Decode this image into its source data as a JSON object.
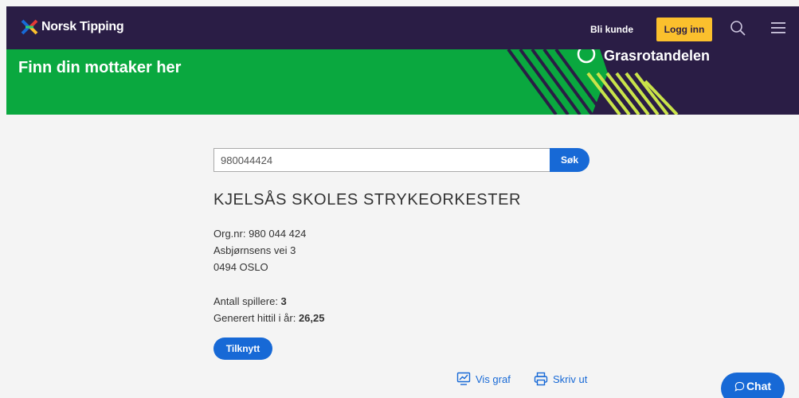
{
  "header": {
    "brand": "Norsk Tipping",
    "bli_kunde": "Bli kunde",
    "logg_inn": "Logg inn",
    "icons": [
      "norsk-tipping-logo-icon",
      "search-icon",
      "menu-icon"
    ]
  },
  "hero": {
    "title": "Finn din mottaker her",
    "badge": "Grasrotandelen"
  },
  "search": {
    "value": "980044424",
    "button": "Søk"
  },
  "org": {
    "name": "KJELSÅS SKOLES STRYKEORKESTER",
    "orgnr": "Org.nr: 980 044 424",
    "address1": "Asbjørnsens vei 3",
    "address2": "0494 OSLO",
    "players_label": "Antall spillere: ",
    "players_value": "3",
    "generated_label": "Generert hittil i år: ",
    "generated_value": "26,25"
  },
  "actions": {
    "tilknytt": "Tilknytt",
    "vis_graf": "Vis graf",
    "skriv_ut": "Skriv ut",
    "chat": "Chat"
  },
  "colors": {
    "header_bg": "#2a1d45",
    "hero_green": "#0aa83f",
    "accent_blue": "#1769d6",
    "login_yellow": "#fbc02d"
  }
}
